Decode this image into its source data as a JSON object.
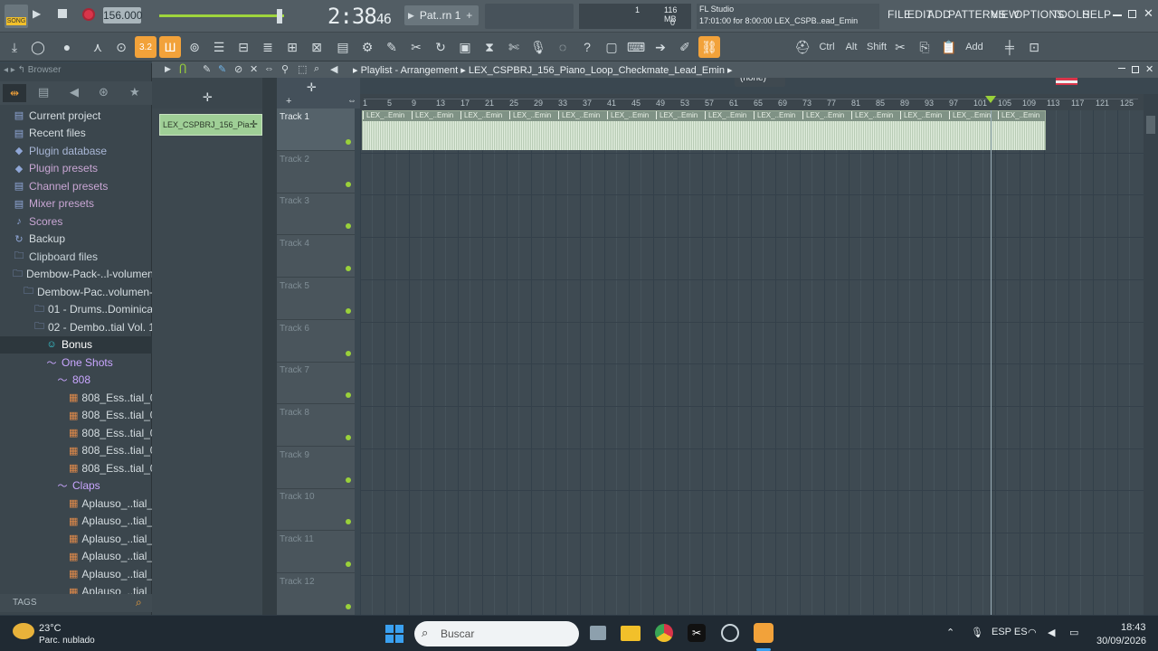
{
  "topbar": {
    "song_label": "SONG",
    "tempo": "156.000",
    "time": "2:38",
    "time_sub": "46",
    "pattern": "Pat..rn 1",
    "cpu_value": "1",
    "mem": "116 MB",
    "mem_sub": "0",
    "app_name": "FL Studio",
    "hint": "17:01:00 for 8:00:00  LEX_CSPB..ead_Emin",
    "menus": [
      "FILE",
      "EDIT",
      "ADD",
      "PATTERNS",
      "VIEW",
      "OPTIONS",
      "TOOLS",
      "HELP"
    ]
  },
  "toolbar": {
    "snap_value": "3.2",
    "none_select": "(none)",
    "keys": [
      "Ctrl",
      "Alt",
      "Shift"
    ],
    "add_label": "Add"
  },
  "browser": {
    "title": "Browser",
    "items": [
      {
        "label": "Current project",
        "color": "#d5dde1",
        "icon": "project-icon",
        "indent": 0
      },
      {
        "label": "Recent files",
        "color": "#d5dde1",
        "icon": "recent-icon",
        "indent": 0
      },
      {
        "label": "Plugin database",
        "color": "#a9b7d6",
        "icon": "plug-icon",
        "indent": 0
      },
      {
        "label": "Plugin presets",
        "color": "#c9a6d4",
        "icon": "plug-icon",
        "indent": 0
      },
      {
        "label": "Channel presets",
        "color": "#c9a6d4",
        "icon": "channel-icon",
        "indent": 0
      },
      {
        "label": "Mixer presets",
        "color": "#c9a6d4",
        "icon": "mixer-icon",
        "indent": 0
      },
      {
        "label": "Scores",
        "color": "#c9a6d4",
        "icon": "note-icon",
        "indent": 0
      },
      {
        "label": "Backup",
        "color": "#d5dde1",
        "icon": "backup-icon",
        "indent": 0
      },
      {
        "label": "Clipboard files",
        "color": "#c9d4da",
        "icon": "folder-icon",
        "indent": 0
      },
      {
        "label": "Dembow-Pack-..l-volumen-1",
        "color": "#d5dde1",
        "icon": "folder-icon",
        "indent": 0
      },
      {
        "label": "Dembow-Pac..volumen-1",
        "color": "#d5dde1",
        "icon": "folder-icon",
        "indent": 1
      },
      {
        "label": "01 - Drums..Dominicano",
        "color": "#d5dde1",
        "icon": "folder-icon",
        "indent": 2
      },
      {
        "label": "02 - Dembo..tial Vol. 1",
        "color": "#d5dde1",
        "icon": "folder-icon",
        "indent": 2
      },
      {
        "label": "Bonus",
        "color": "#ffffff",
        "icon": "smile-icon",
        "indent": 3
      },
      {
        "label": "One Shots",
        "color": "#c9a6ff",
        "icon": "wave-icon",
        "indent": 3
      },
      {
        "label": "808",
        "color": "#c9a6ff",
        "icon": "wave-icon",
        "indent": 4
      },
      {
        "label": "808_Ess..tial_01",
        "color": "#d5dde1",
        "icon": "sample-icon",
        "indent": 5
      },
      {
        "label": "808_Ess..tial_02",
        "color": "#d5dde1",
        "icon": "sample-icon",
        "indent": 5
      },
      {
        "label": "808_Ess..tial_03",
        "color": "#d5dde1",
        "icon": "sample-icon",
        "indent": 5
      },
      {
        "label": "808_Ess..tial_04",
        "color": "#d5dde1",
        "icon": "sample-icon",
        "indent": 5
      },
      {
        "label": "808_Ess..tial_05",
        "color": "#d5dde1",
        "icon": "sample-icon",
        "indent": 5
      },
      {
        "label": "Claps",
        "color": "#c9a6ff",
        "icon": "wave-icon",
        "indent": 4
      },
      {
        "label": "Aplauso_..tial_01",
        "color": "#d5dde1",
        "icon": "sample-icon",
        "indent": 5
      },
      {
        "label": "Aplauso_..tial_02",
        "color": "#d5dde1",
        "icon": "sample-icon",
        "indent": 5
      },
      {
        "label": "Aplauso_..tial_03",
        "color": "#d5dde1",
        "icon": "sample-icon",
        "indent": 5
      },
      {
        "label": "Aplauso_..tial_04",
        "color": "#d5dde1",
        "icon": "sample-icon",
        "indent": 5
      },
      {
        "label": "Aplauso_..tial_05",
        "color": "#d5dde1",
        "icon": "sample-icon",
        "indent": 5
      },
      {
        "label": "Aplauso_..tial_06",
        "color": "#d5dde1",
        "icon": "sample-icon",
        "indent": 5
      }
    ],
    "tags_label": "TAGS"
  },
  "playlist": {
    "title": "Playlist - Arrangement",
    "pattern_name": "LEX_CSPBRJ_156_Piano_Loop_Checkmate_Lead_Emin",
    "channel_name": "LEX_CSPBRJ_156_Pia...",
    "ruler": [
      "1",
      "5",
      "9",
      "13",
      "17",
      "21",
      "25",
      "29",
      "33",
      "37",
      "41",
      "45",
      "49",
      "53",
      "57",
      "61",
      "65",
      "69",
      "73",
      "77",
      "81",
      "85",
      "89",
      "93",
      "97",
      "101",
      "105",
      "109",
      "113",
      "117",
      "121",
      "125"
    ],
    "tracks": [
      "Track 1",
      "Track 2",
      "Track 3",
      "Track 4",
      "Track 5",
      "Track 6",
      "Track 7",
      "Track 8",
      "Track 9",
      "Track 10",
      "Track 11",
      "Track 12"
    ],
    "clip_label": "LEX_..Emin",
    "clip_repeats": 14
  },
  "taskbar": {
    "temp": "23°C",
    "weather": "Parc. nublado",
    "search_placeholder": "Buscar",
    "lang": "ESP ES",
    "clock": "18:43",
    "date": "30/09/2026"
  }
}
